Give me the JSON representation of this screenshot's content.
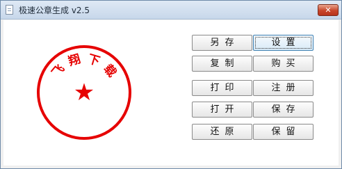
{
  "window": {
    "title": "极速公章生成 v2.5",
    "close_label": "✕"
  },
  "seal": {
    "text": "飞翔下载",
    "color": "#e60000",
    "star": "★"
  },
  "buttons": {
    "save_as": "另存",
    "settings": "设置",
    "copy": "复制",
    "buy": "购买",
    "print": "打印",
    "register": "注册",
    "open": "打开",
    "save": "保存",
    "restore": "还原",
    "keep": "保留"
  },
  "icons": {
    "app": "document-icon",
    "close": "close-icon"
  }
}
